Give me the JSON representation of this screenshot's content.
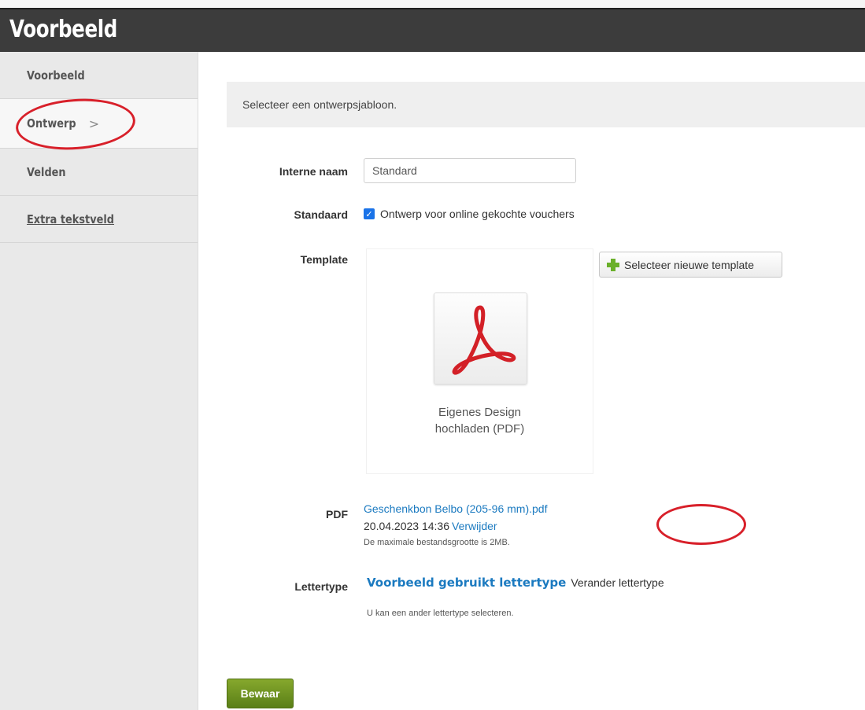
{
  "header": {
    "title": "Voorbeeld"
  },
  "sidebar": {
    "items": [
      {
        "label": "Voorbeeld"
      },
      {
        "label": "Ontwerp",
        "chevron": ">"
      },
      {
        "label": "Velden"
      },
      {
        "label": "Extra tekstveld"
      }
    ]
  },
  "main": {
    "notice": "Selecteer een ontwerpsjabloon.",
    "internal_name": {
      "label": "Interne naam",
      "value": "Standard"
    },
    "default": {
      "label": "Standaard",
      "checkbox_label": "Ontwerp voor online gekochte vouchers",
      "checked": true
    },
    "template": {
      "label": "Template",
      "card_caption_line1": "Eigenes Design",
      "card_caption_line2": "hochladen (PDF)",
      "select_button": "Selecteer nieuwe template"
    },
    "pdf": {
      "label": "PDF",
      "filename": "Geschenkbon Belbo (205-96 mm).pdf",
      "date": "20.04.2023 14:36",
      "remove_link": "Verwijder",
      "note": "De maximale bestandsgrootte is 2MB."
    },
    "font": {
      "label": "Lettertype",
      "sample": "Voorbeeld gebruikt lettertype",
      "change_link": "Verander lettertype",
      "note": "U kan een ander lettertype selecteren."
    },
    "save_button": "Bewaar"
  },
  "colors": {
    "header_bg": "#3c3c3c",
    "link": "#1b7ac0",
    "save_button": "#6a8f1f",
    "highlight": "#d8202a",
    "pdf_red": "#d32027"
  },
  "icons": [
    "chevron-right-icon",
    "checkbox-checked-icon",
    "acrobat-pdf-icon",
    "plus-icon"
  ]
}
